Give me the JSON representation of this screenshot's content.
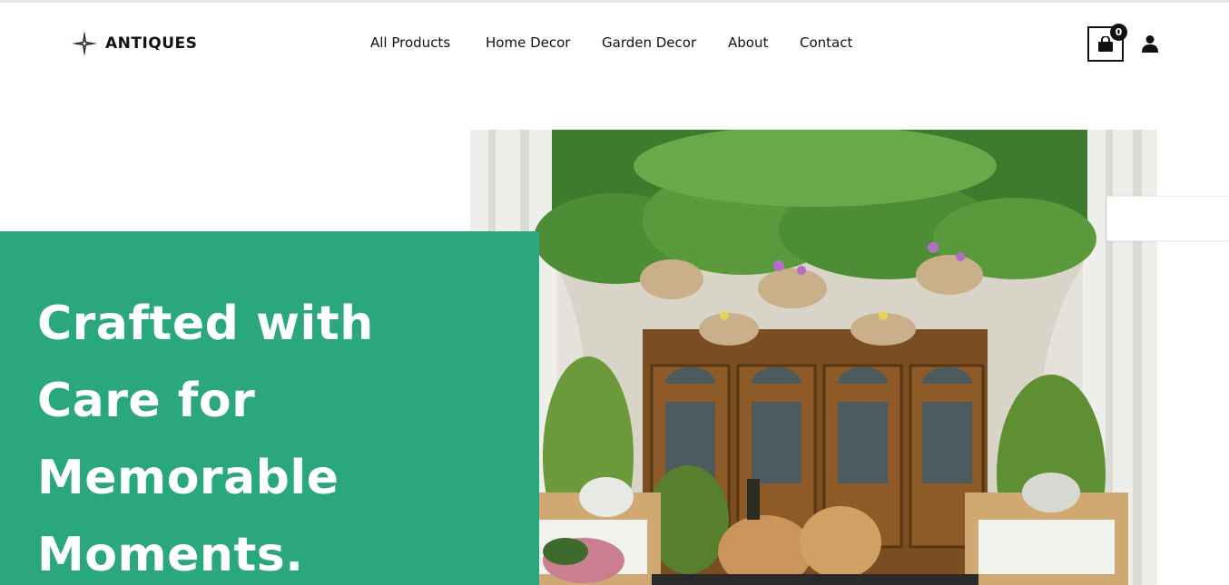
{
  "brand": {
    "name": "ANTIQUES",
    "logo_icon": "compass-star-icon"
  },
  "nav": {
    "items": [
      {
        "label": "All Products"
      },
      {
        "label": "Home Decor"
      },
      {
        "label": "Garden Decor"
      },
      {
        "label": "About"
      },
      {
        "label": "Contact"
      }
    ]
  },
  "header_actions": {
    "cart_icon": "shopping-bag-icon",
    "cart_count": "0",
    "user_icon": "user-icon"
  },
  "hero": {
    "title": "Crafted with Care for Memorable Moments.",
    "panel_color": "#2ba780"
  }
}
